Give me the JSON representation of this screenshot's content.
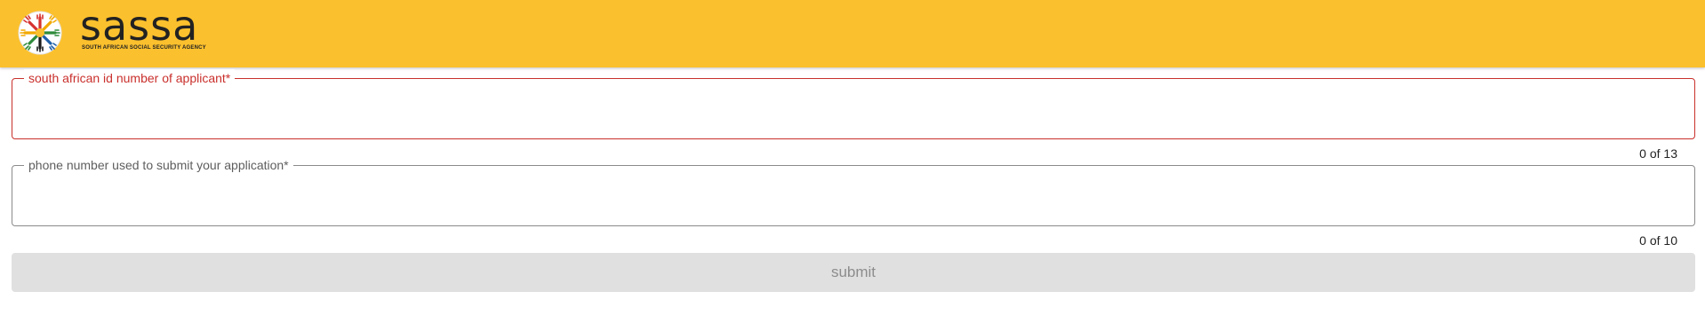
{
  "header": {
    "brand_name": "sassa",
    "brand_subtitle": "SOUTH AFRICAN SOCIAL SECURITY AGENCY",
    "logo_icon": "sassa-hands-logo-icon",
    "background_color": "#fbc02d"
  },
  "form": {
    "id_field": {
      "label": "south african id number of applicant*",
      "value": "",
      "counter": "0 of 13",
      "state": "error",
      "border_color": "#c9302c"
    },
    "phone_field": {
      "label": "phone number used to submit your application*",
      "value": "",
      "counter": "0 of 10",
      "state": "normal",
      "border_color": "#8a8a8a"
    },
    "submit": {
      "label": "submit",
      "disabled": true
    }
  }
}
